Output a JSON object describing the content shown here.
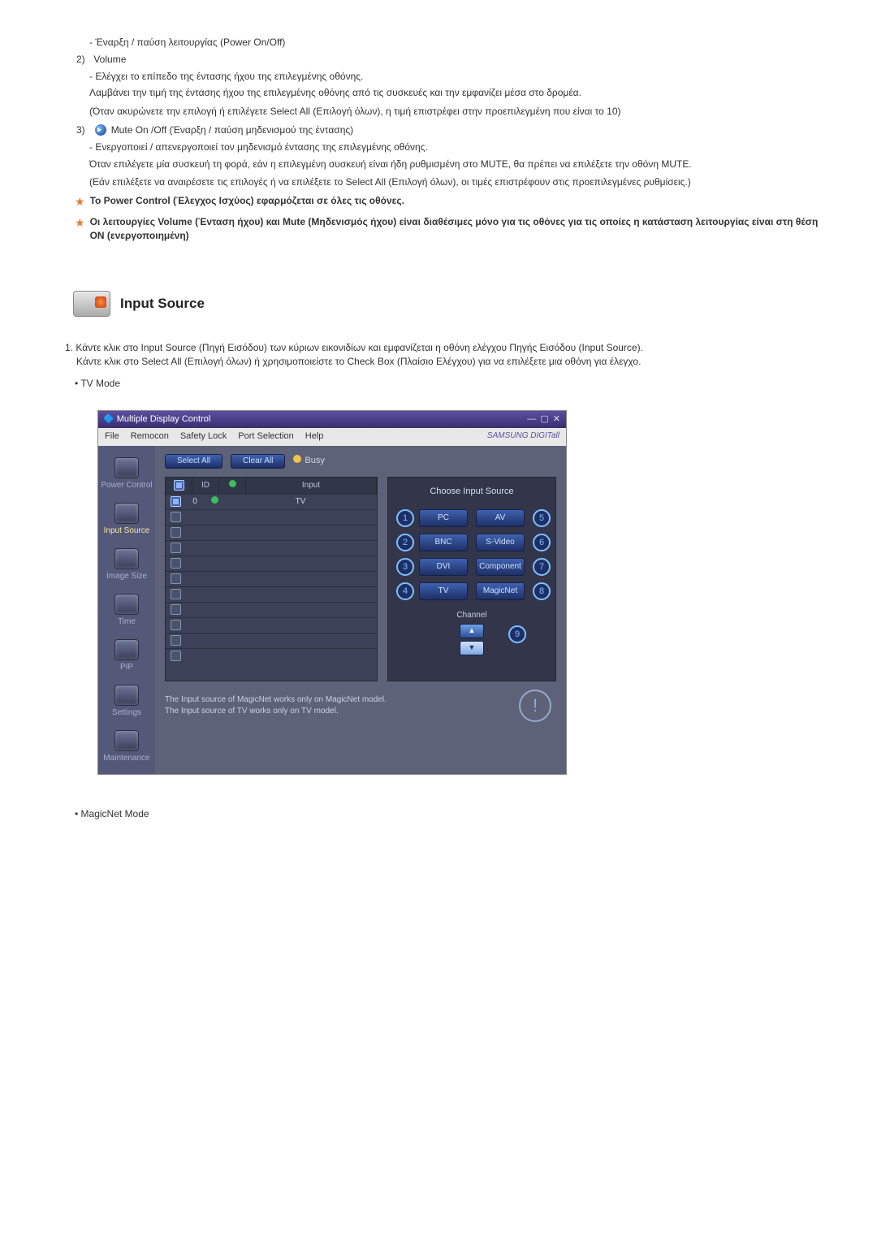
{
  "upper": {
    "power_onoff": "- Έναρξη / παύση λειτουργίας (Power On/Off)",
    "volume_num": "2)",
    "volume_label": "Volume",
    "vol_p1": "- Ελέγχει το επίπεδο της έντασης ήχου της επιλεγμένης οθόνης.",
    "vol_p2": "Λαμβάνει την τιμή της έντασης ήχου της επιλεγμένης οθόνης από τις συσκευές και την εμφανίζει μέσα στο δρομέα.",
    "vol_p3": "(Όταν ακυρώνετε την επιλογή ή επιλέγετε Select All (Επιλογή όλων), η τιμή επιστρέφει στην προεπιλεγμένη που είναι το 10)",
    "mute_num": "3)",
    "mute_label": "Mute On /Off (Έναρξη / παύση μηδενισμού της έντασης)",
    "mute_p1": "- Ενεργοποιεί / απενεργοποιεί τον μηδενισμό έντασης της επιλεγμένης οθόνης.",
    "mute_p2": "Όταν επιλέγετε μία συσκευή τη φορά, εάν η επιλεγμένη συσκευή είναι ήδη ρυθμισμένη στο MUTE, θα πρέπει να επιλέξετε την οθόνη MUTE.",
    "mute_p3": "(Εάν επιλέξετε να αναιρέσετε τις επιλογές ή να επιλέξετε το Select All (Επιλογή όλων), οι τιμές επιστρέφουν στις προεπιλεγμένες ρυθμίσεις.)",
    "star1": "Το Power Control (Έλεγχος Ισχύος) εφαρμόζεται σε όλες τις οθόνες.",
    "star2": "Οι λειτουργίες Volume (Ένταση ήχου) και Mute (Μηδενισμός ήχου) είναι διαθέσιμες μόνο για τις οθόνες για τις οποίες η κατάσταση λειτουργίας είναι στη θέση ON (ενεργοποιημένη)"
  },
  "section": {
    "title": "Input Source",
    "p1": "Κάντε κλικ στο Input Source (Πηγή Εισόδου) των κύριων εικονιδίων και εμφανίζεται η οθόνη ελέγχου Πηγής Εισόδου (Input Source).",
    "p2": "Κάντε κλικ στο Select All (Επιλογή όλων) ή χρησιμοποιείστε το Check Box (Πλαίσιο Ελέγχου) για να επιλέξετε μια οθόνη για έλεγχο.",
    "bullet_tv": "TV Mode",
    "bullet_mn": "MagicNet Mode"
  },
  "shot": {
    "title": "Multiple Display Control",
    "menu": [
      "File",
      "Remocon",
      "Safety Lock",
      "Port Selection",
      "Help"
    ],
    "logo": "SAMSUNG DIGITall",
    "sidebar": [
      "Power Control",
      "Input Source",
      "Image Size",
      "Time",
      "PIP",
      "Settings",
      "Maintenance"
    ],
    "select_all": "Select All",
    "clear_all": "Clear All",
    "busy": "Busy",
    "col_id": "ID",
    "col_input": "Input",
    "rows": [
      {
        "id": "0",
        "checked": true,
        "status": true,
        "val": "TV"
      },
      {
        "id": "",
        "checked": false,
        "status": false,
        "val": ""
      },
      {
        "id": "",
        "checked": false,
        "status": false,
        "val": ""
      },
      {
        "id": "",
        "checked": false,
        "status": false,
        "val": ""
      },
      {
        "id": "",
        "checked": false,
        "status": false,
        "val": ""
      },
      {
        "id": "",
        "checked": false,
        "status": false,
        "val": ""
      },
      {
        "id": "",
        "checked": false,
        "status": false,
        "val": ""
      },
      {
        "id": "",
        "checked": false,
        "status": false,
        "val": ""
      },
      {
        "id": "",
        "checked": false,
        "status": false,
        "val": ""
      },
      {
        "id": "",
        "checked": false,
        "status": false,
        "val": ""
      },
      {
        "id": "",
        "checked": false,
        "status": false,
        "val": ""
      }
    ],
    "panel_title": "Choose Input Source",
    "sources_left": [
      "PC",
      "BNC",
      "DVI",
      "TV"
    ],
    "sources_right": [
      "AV",
      "S-Video",
      "Component",
      "MagicNet"
    ],
    "nums_left": [
      "1",
      "2",
      "3",
      "4"
    ],
    "nums_right": [
      "5",
      "6",
      "7",
      "8"
    ],
    "channel_label": "Channel",
    "ch_up": "▲",
    "ch_down": "▼",
    "num9": "9",
    "note1": "The Input source of MagicNet works only on MagicNet model.",
    "note2": "The Input source of TV works only on TV  model."
  }
}
